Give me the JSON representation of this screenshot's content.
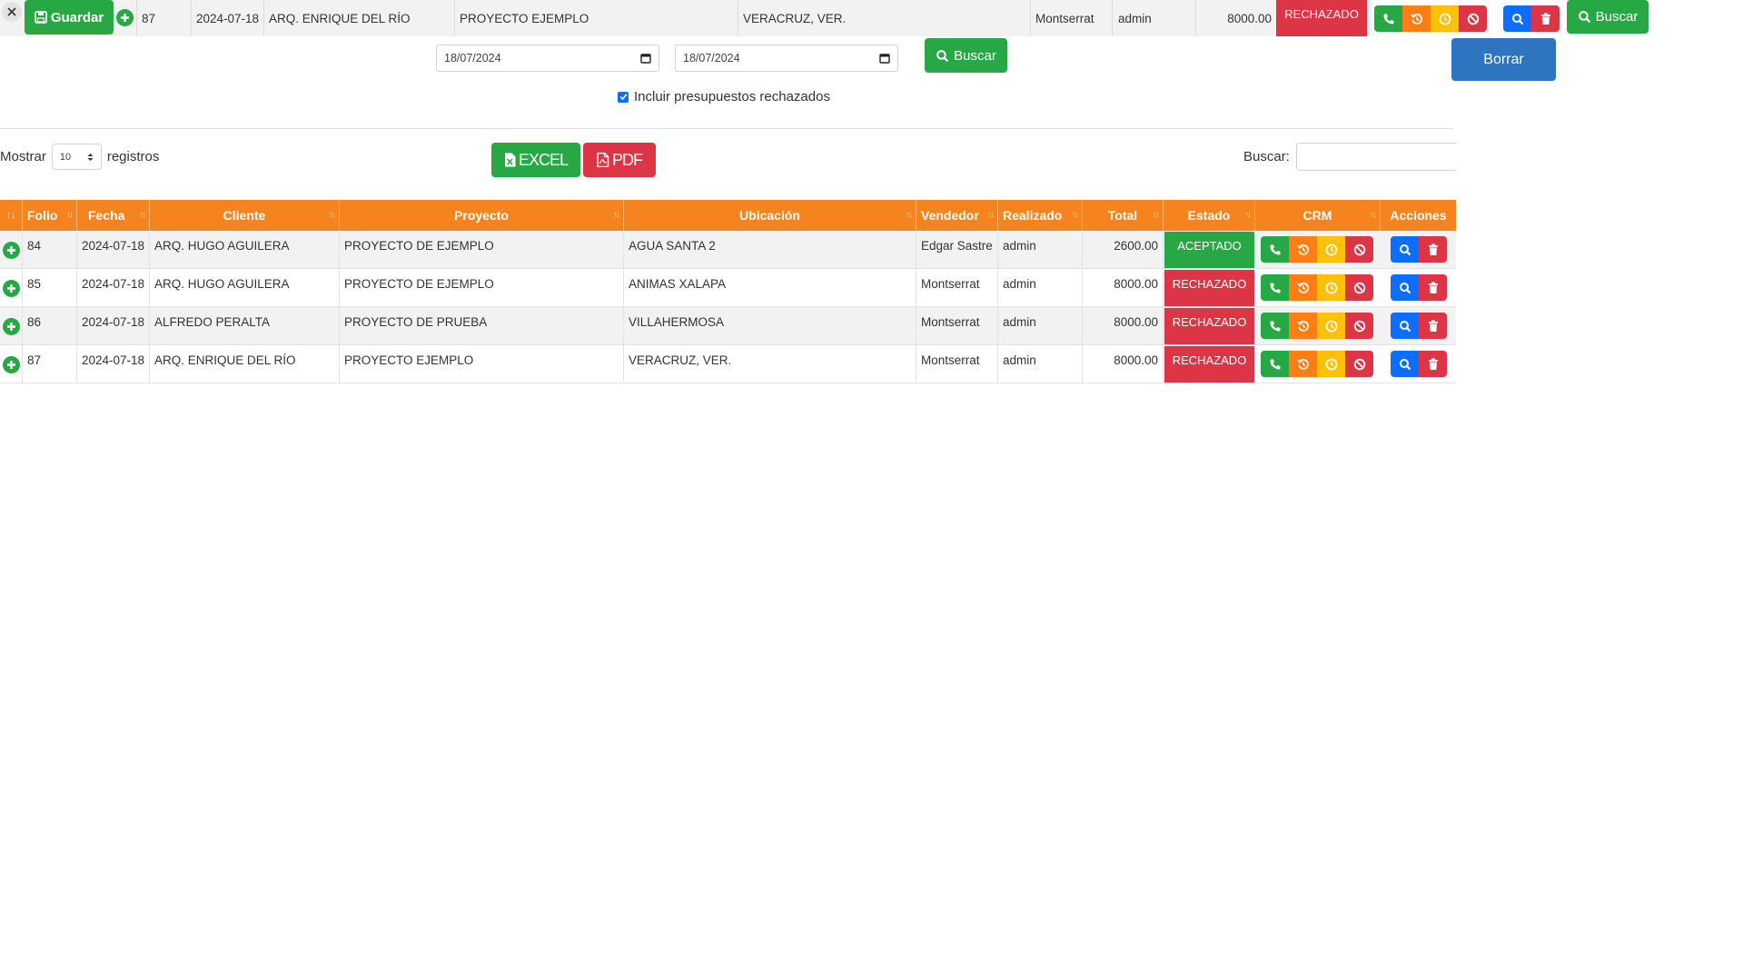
{
  "top_row": {
    "save_label": "Guardar",
    "folio": "87",
    "fecha": "2024-07-18",
    "cliente": "ARQ. ENRIQUE DEL RÍO",
    "proyecto": "PROYECTO EJEMPLO",
    "ubicacion": "VERACRUZ, VER.",
    "vendedor": "Montserrat",
    "realizado": "admin",
    "total": "8000.00",
    "estado": "RECHAZADO",
    "search_label": "Buscar"
  },
  "filters": {
    "date_from": "18/07/2024",
    "date_to": "18/07/2024",
    "search_label": "Buscar",
    "delete_label": "Borrar",
    "include_rejected_label": "Incluir presupuestos rechazados",
    "include_rejected_checked": true
  },
  "controls": {
    "show_label": "Mostrar",
    "show_value": "10",
    "records_label": "registros",
    "excel_label": "EXCEL",
    "pdf_label": "PDF",
    "search_label": "Buscar:"
  },
  "table": {
    "headers": [
      "Folio",
      "Fecha",
      "Cliente",
      "Proyecto",
      "Ubicación",
      "Vendedor",
      "Realizado",
      "Total",
      "Estado",
      "CRM",
      "Acciones"
    ],
    "rows": [
      {
        "folio": "84",
        "fecha": "2024-07-18",
        "cliente": "ARQ. HUGO AGUILERA",
        "proyecto": "PROYECTO DE EJEMPLO",
        "ubicacion": "AGUA SANTA 2",
        "vendedor": "Edgar Sastre",
        "realizado": "admin",
        "total": "2600.00",
        "estado": "ACEPTADO"
      },
      {
        "folio": "85",
        "fecha": "2024-07-18",
        "cliente": "ARQ. HUGO AGUILERA",
        "proyecto": "PROYECTO DE EJEMPLO",
        "ubicacion": "ANIMAS XALAPA",
        "vendedor": "Montserrat",
        "realizado": "admin",
        "total": "8000.00",
        "estado": "RECHAZADO"
      },
      {
        "folio": "86",
        "fecha": "2024-07-18",
        "cliente": "ALFREDO PERALTA",
        "proyecto": "PROYECTO DE PRUEBA",
        "ubicacion": "VILLAHERMOSA",
        "vendedor": "Montserrat",
        "realizado": "admin",
        "total": "8000.00",
        "estado": "RECHAZADO"
      },
      {
        "folio": "87",
        "fecha": "2024-07-18",
        "cliente": "ARQ. ENRIQUE DEL RÍO",
        "proyecto": "PROYECTO EJEMPLO",
        "ubicacion": "VERACRUZ, VER.",
        "vendedor": "Montserrat",
        "realizado": "admin",
        "total": "8000.00",
        "estado": "RECHAZADO"
      }
    ]
  },
  "colors": {
    "header_orange": "#f5841f",
    "success_green": "#28a745",
    "danger_red": "#dc3545",
    "warning_yellow": "#ffc107",
    "orange_button": "#fd7e14",
    "primary_blue": "#0d6efd",
    "borrar_blue": "#2e75c0"
  },
  "icons": {
    "crm": [
      "phone-icon",
      "history-icon",
      "clock-icon",
      "ban-icon"
    ],
    "actions": [
      "search-icon",
      "trash-icon"
    ],
    "row_expand": "plus-circle-icon"
  }
}
